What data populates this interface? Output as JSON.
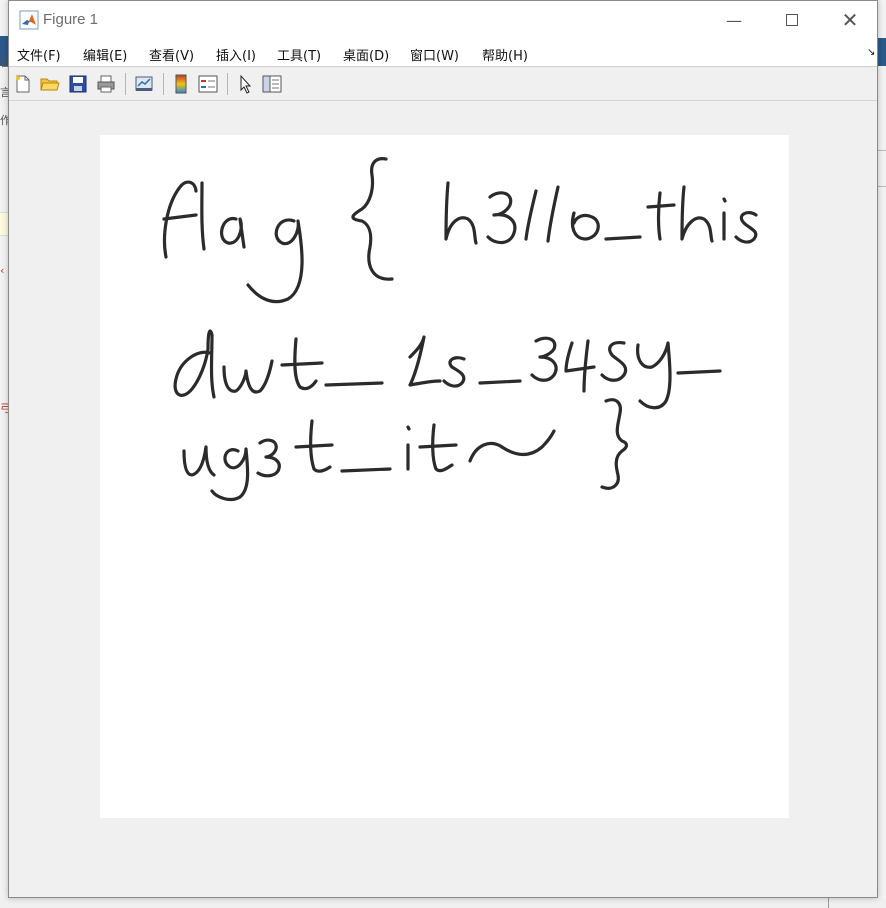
{
  "window": {
    "title": "Figure 1",
    "controls": {
      "minimize": "—",
      "close": "✕"
    }
  },
  "menubar": {
    "items": [
      {
        "label": "文件(F)"
      },
      {
        "label": "编辑(E)"
      },
      {
        "label": "查看(V)"
      },
      {
        "label": "插入(I)"
      },
      {
        "label": "工具(T)"
      },
      {
        "label": "桌面(D)"
      },
      {
        "label": "窗口(W)"
      },
      {
        "label": "帮助(H)"
      }
    ],
    "corner_glyph": "↘"
  },
  "toolbar": {
    "tools": [
      "new-figure-icon",
      "open-folder-icon",
      "save-icon",
      "print-icon",
      "link-plot-icon",
      "colorbar-icon",
      "legend-icon",
      "pointer-icon",
      "property-inspector-icon"
    ]
  },
  "figure": {
    "handwritten_lines": [
      "flag{ h3llo_this",
      "dwt_1s_345y_",
      "ug3t_it~}"
    ]
  },
  "colors": {
    "accent": "#2b5a8a",
    "ink": "#2b2b2b",
    "axes_bg": "#ffffff",
    "window_bg": "#f0f0f0"
  }
}
